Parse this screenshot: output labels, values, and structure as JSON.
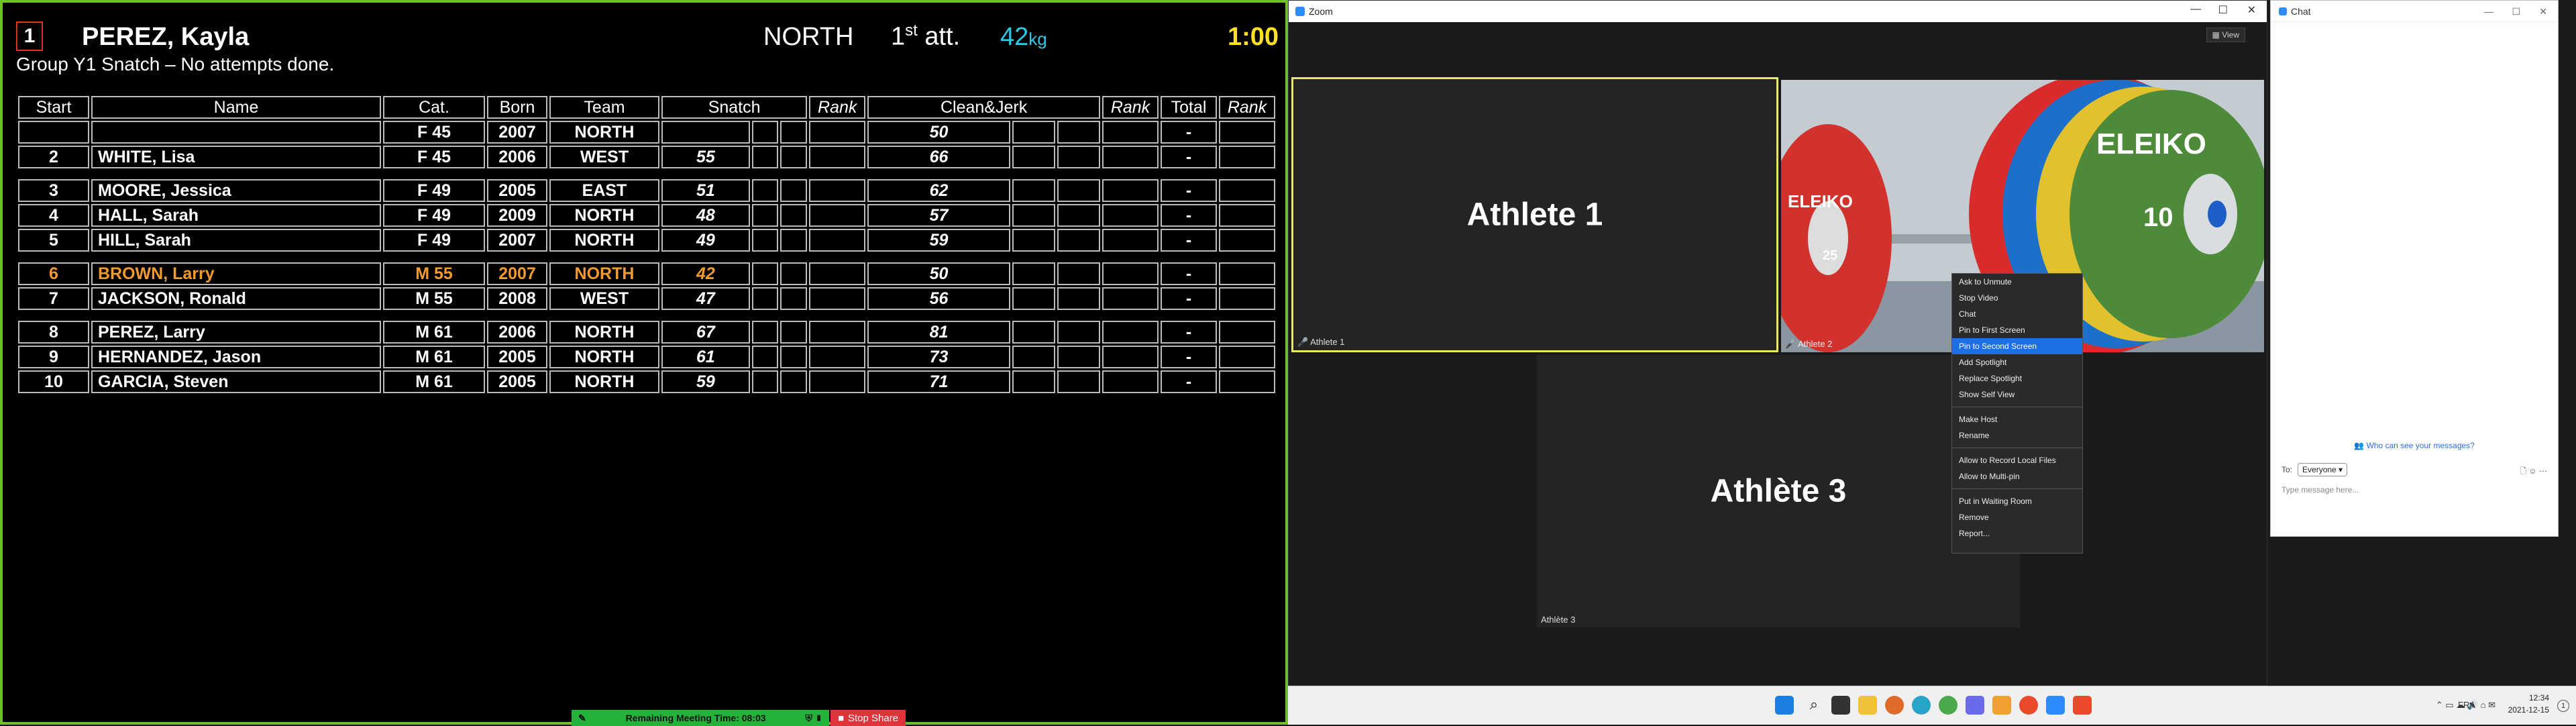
{
  "scoreboard": {
    "current": {
      "start": "1",
      "name": "PEREZ, Kayla",
      "team": "NORTH",
      "attempt_num": "1",
      "attempt_sup": "st",
      "attempt_word": "att.",
      "weight": "42",
      "weight_unit": "kg",
      "clock": "1:00"
    },
    "group_line": "Group Y1 Snatch – No attempts done.",
    "headers": [
      "Start",
      "Name",
      "Cat.",
      "Born",
      "Team",
      "Snatch",
      "Rank",
      "Clean&Jerk",
      "Rank",
      "Total",
      "Rank"
    ],
    "rows": [
      {
        "start": "",
        "name": "",
        "cat": "F 45",
        "born": "2007",
        "team": "NORTH",
        "sn": [
          "",
          "",
          ""
        ],
        "snr": "",
        "cj": [
          "50",
          "",
          ""
        ],
        "cjr": "",
        "total": "-",
        "rank": ""
      },
      {
        "start": "2",
        "name": "WHITE, Lisa",
        "cat": "F 45",
        "born": "2006",
        "team": "WEST",
        "sn": [
          "55",
          "",
          ""
        ],
        "snr": "",
        "cj": [
          "66",
          "",
          ""
        ],
        "cjr": "",
        "total": "-",
        "rank": ""
      },
      {
        "gap": true
      },
      {
        "start": "3",
        "name": "MOORE, Jessica",
        "cat": "F 49",
        "born": "2005",
        "team": "EAST",
        "sn": [
          "51",
          "",
          ""
        ],
        "snr": "",
        "cj": [
          "62",
          "",
          ""
        ],
        "cjr": "",
        "total": "-",
        "rank": ""
      },
      {
        "start": "4",
        "name": "HALL, Sarah",
        "cat": "F 49",
        "born": "2009",
        "team": "NORTH",
        "sn": [
          "48",
          "",
          ""
        ],
        "snr": "",
        "cj": [
          "57",
          "",
          ""
        ],
        "cjr": "",
        "total": "-",
        "rank": ""
      },
      {
        "start": "5",
        "name": "HILL, Sarah",
        "cat": "F 49",
        "born": "2007",
        "team": "NORTH",
        "sn": [
          "49",
          "",
          ""
        ],
        "snr": "",
        "cj": [
          "59",
          "",
          ""
        ],
        "cjr": "",
        "total": "-",
        "rank": ""
      },
      {
        "gap": true
      },
      {
        "start": "6",
        "name": "BROWN, Larry",
        "cat": "M 55",
        "born": "2007",
        "team": "NORTH",
        "sn": [
          "42",
          "",
          ""
        ],
        "snr": "",
        "cj": [
          "50",
          "",
          ""
        ],
        "cjr": "",
        "total": "-",
        "rank": "",
        "current": true
      },
      {
        "start": "7",
        "name": "JACKSON, Ronald",
        "cat": "M 55",
        "born": "2008",
        "team": "WEST",
        "sn": [
          "47",
          "",
          ""
        ],
        "snr": "",
        "cj": [
          "56",
          "",
          ""
        ],
        "cjr": "",
        "total": "-",
        "rank": ""
      },
      {
        "gap": true
      },
      {
        "start": "8",
        "name": "PEREZ, Larry",
        "cat": "M 61",
        "born": "2006",
        "team": "NORTH",
        "sn": [
          "67",
          "",
          ""
        ],
        "snr": "",
        "cj": [
          "81",
          "",
          ""
        ],
        "cjr": "",
        "total": "-",
        "rank": ""
      },
      {
        "start": "9",
        "name": "HERNANDEZ, Jason",
        "cat": "M 61",
        "born": "2005",
        "team": "NORTH",
        "sn": [
          "61",
          "",
          ""
        ],
        "snr": "",
        "cj": [
          "73",
          "",
          ""
        ],
        "cjr": "",
        "total": "-",
        "rank": ""
      },
      {
        "start": "10",
        "name": "GARCIA, Steven",
        "cat": "M 61",
        "born": "2005",
        "team": "NORTH",
        "sn": [
          "59",
          "",
          ""
        ],
        "snr": "",
        "cj": [
          "71",
          "",
          ""
        ],
        "cjr": "",
        "total": "-",
        "rank": ""
      }
    ],
    "meeting_bar": "Remaining Meeting Time: 08:03",
    "stop_share": "Stop Share",
    "border_color": "#6fbf2a",
    "highlight_color": "#f39a2c",
    "weight_color": "#2ec8e8",
    "clock_color": "#ffe021"
  },
  "zoom": {
    "title": "Zoom",
    "view_label": "View",
    "tile1": {
      "label": "Athlete 1",
      "caption": "Athlete 1"
    },
    "tile2": {
      "caption": "Athlete 2",
      "plate1": "ELEIKO",
      "plate1_num": "10",
      "plate2": "ELEIKO",
      "plate2_num": "25"
    },
    "tile3": {
      "label": "Athlète 3",
      "caption": "Athlète 3"
    },
    "context_menu": [
      "Ask to Unmute",
      "Stop Video",
      "Chat",
      "Pin to First Screen",
      "Pin to Second Screen",
      "Add Spotlight",
      "Replace Spotlight",
      "Show Self View",
      "-",
      "Make Host",
      "Rename",
      "-",
      "Allow to Record Local Files",
      "Allow to Multi-pin",
      "-",
      "Put in Waiting Room",
      "Remove",
      "Report..."
    ],
    "selected_item": "Pin to Second Screen"
  },
  "chat": {
    "title": "Chat",
    "who_can_see": "Who can see your messages?",
    "to_label": "To:",
    "to_value": "Everyone",
    "placeholder": "Type message here..."
  },
  "taskbar": {
    "lang": "FRA",
    "time": "12:34",
    "date": "2021-12-15",
    "notifications": "1"
  }
}
